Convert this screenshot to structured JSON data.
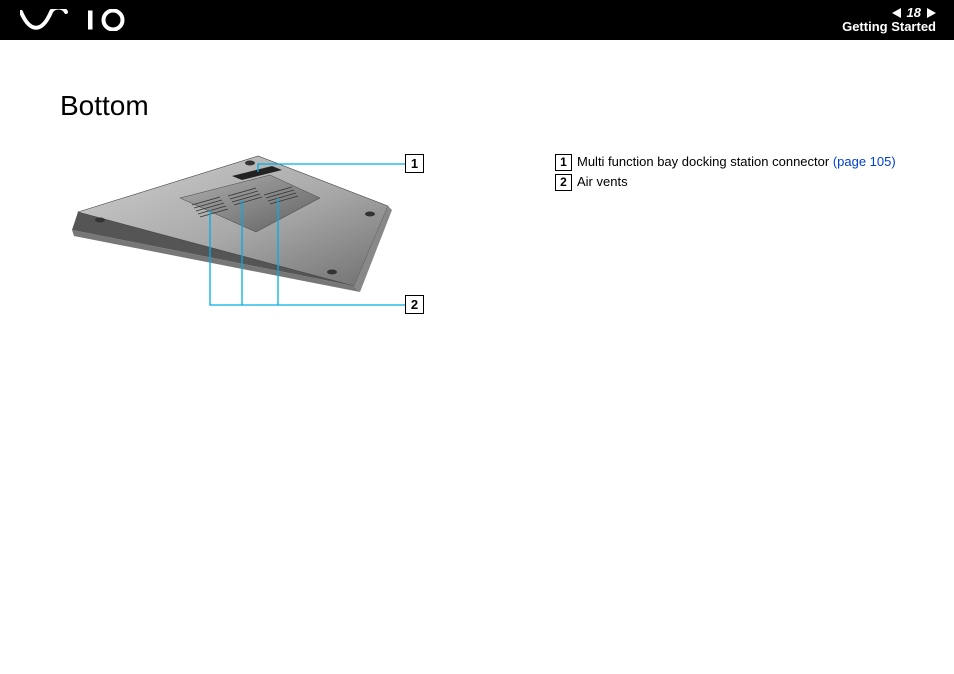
{
  "header": {
    "page_number": "18",
    "section": "Getting Started"
  },
  "page_title": "Bottom",
  "callouts": {
    "one": "1",
    "two": "2"
  },
  "legend": {
    "item1_num": "1",
    "item1_text": "Multi function bay docking station connector ",
    "item1_ref": "(page 105)",
    "item2_num": "2",
    "item2_text": "Air vents"
  }
}
